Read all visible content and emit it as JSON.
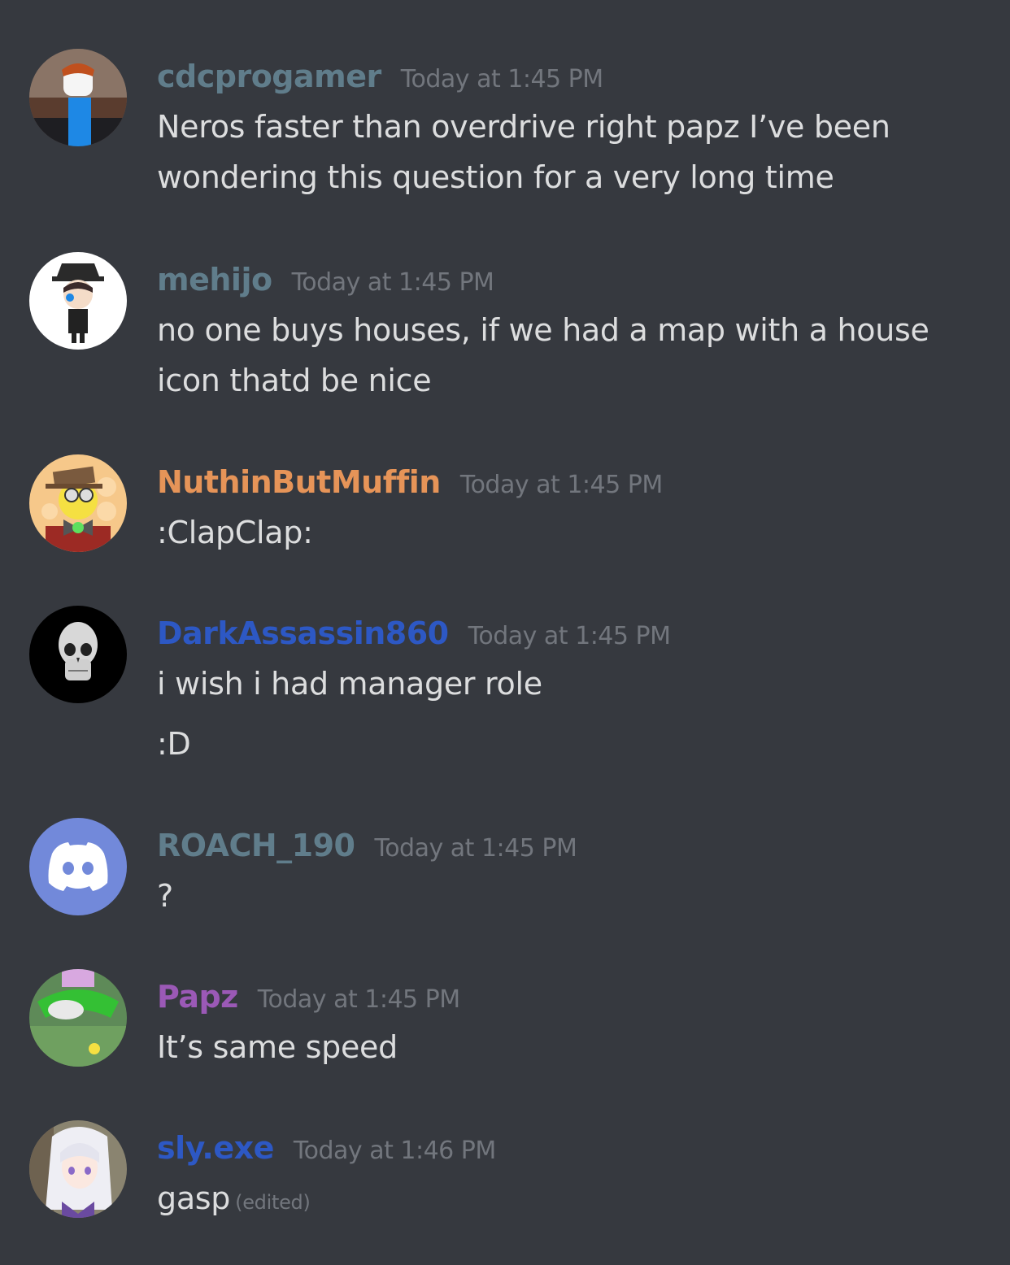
{
  "channel": {
    "messages": [
      {
        "author": "cdcprogamer",
        "author_color": "#607d8b",
        "timestamp": "Today at 1:45 PM",
        "avatar": "roblox-character-avatar",
        "lines": [
          "Neros faster than overdrive right papz I’ve been",
          "wondering this question for a very long time"
        ]
      },
      {
        "author": "mehijo",
        "author_color": "#607d8b",
        "timestamp": "Today at 1:45 PM",
        "avatar": "anime-character-hat-avatar",
        "lines": [
          "no one buys houses, if we had a map with a house",
          "icon thatd be nice"
        ]
      },
      {
        "author": "NuthinButMuffin",
        "author_color": "#e69458",
        "timestamp": "Today at 1:45 PM",
        "avatar": "top-hat-character-avatar",
        "lines": [
          ":ClapClap:"
        ]
      },
      {
        "author": "DarkAssassin860",
        "author_color": "#2d58c4",
        "timestamp": "Today at 1:45 PM",
        "avatar": "skull-avatar",
        "lines": [
          "i wish i had manager role",
          ":D"
        ]
      },
      {
        "author": "ROACH_190",
        "author_color": "#607d8b",
        "timestamp": "Today at 1:45 PM",
        "avatar": "discord-default-avatar",
        "avatar_color": "#7289da",
        "lines": [
          "?"
        ]
      },
      {
        "author": "Papz",
        "author_color": "#9b59b6",
        "timestamp": "Today at 1:45 PM",
        "avatar": "green-hat-avatar",
        "lines": [
          "It’s same speed"
        ]
      },
      {
        "author": "sly.exe",
        "author_color": "#2d58c4",
        "timestamp": "Today at 1:46 PM",
        "avatar": "anime-girl-avatar",
        "lines": [
          "gasp"
        ],
        "edited_label": "(edited)"
      }
    ]
  }
}
